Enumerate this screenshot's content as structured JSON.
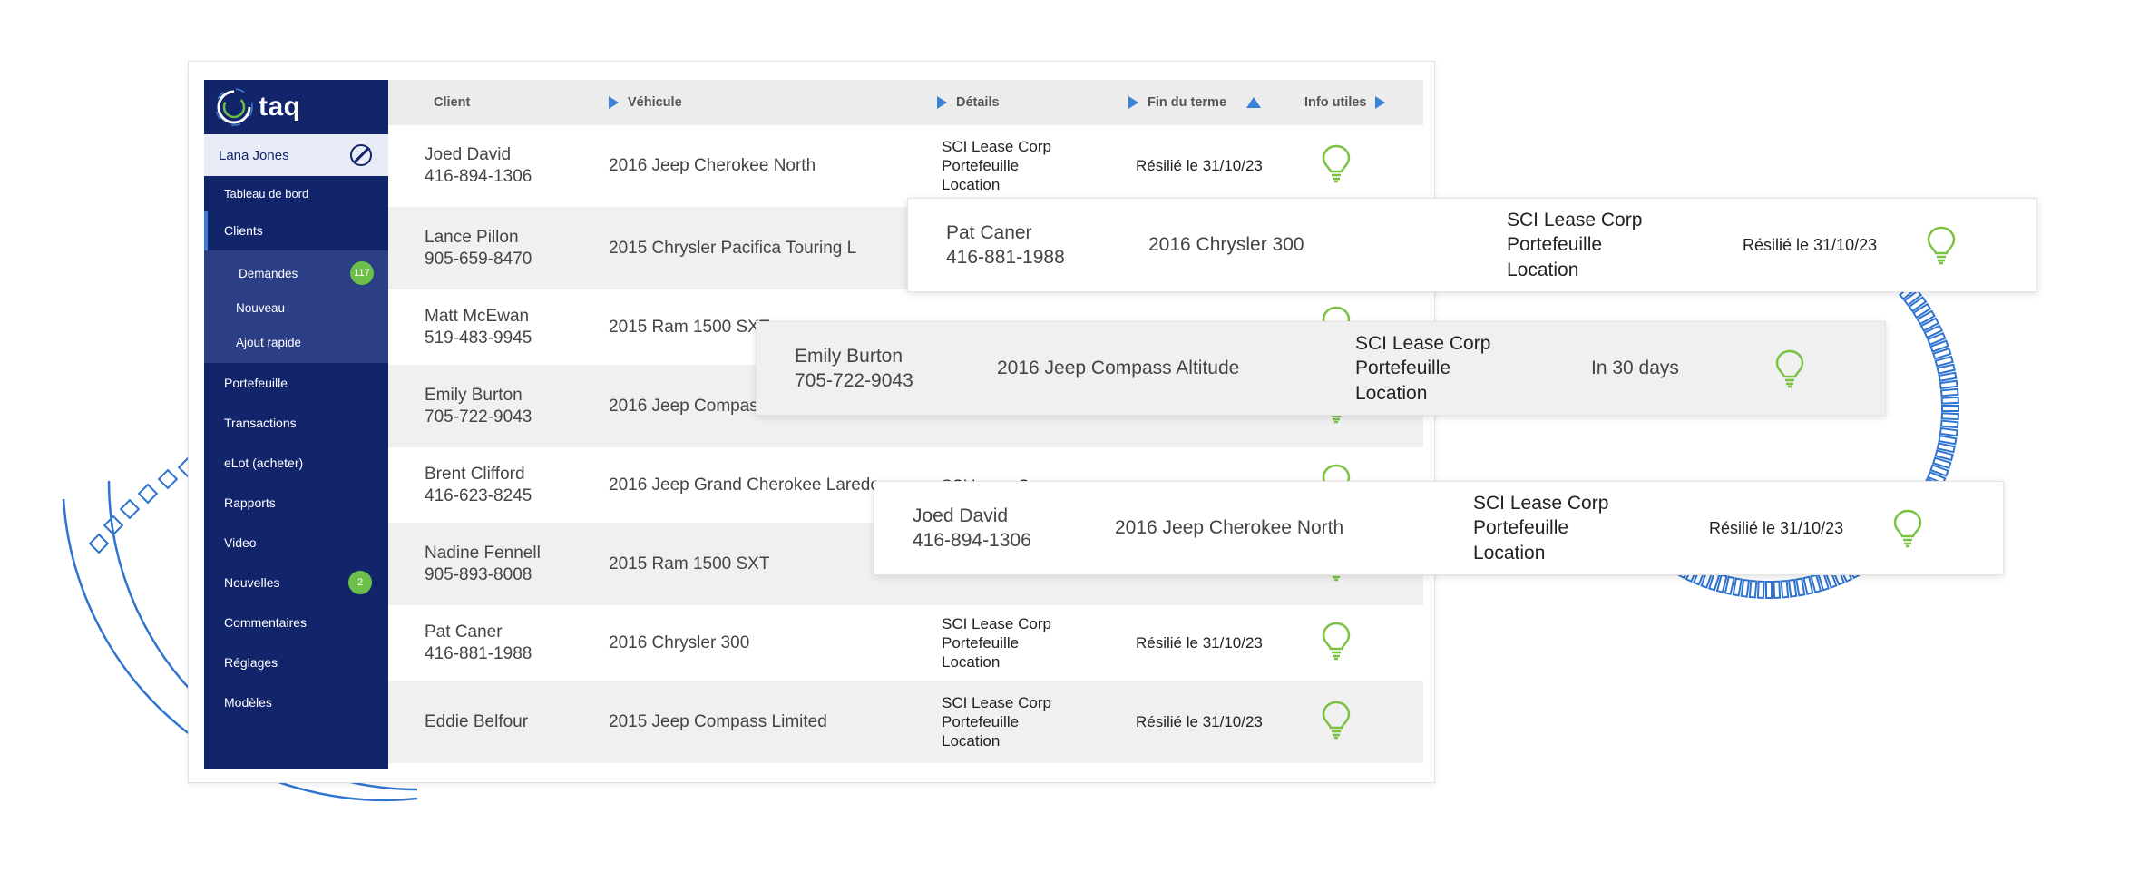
{
  "brand": {
    "logo_text": "taq",
    "accent": "#12246a",
    "link_blue": "#3b82d6",
    "badge_green": "#6cc04a"
  },
  "user": {
    "name": "Lana Jones"
  },
  "sidebar": {
    "overlap_label": "Tableau de bord",
    "clients_label": "Clients",
    "sub_items": [
      {
        "label": "Demandes",
        "badge": "117"
      },
      {
        "label": "Nouveau"
      },
      {
        "label": "Ajout rapide"
      }
    ],
    "items": [
      {
        "label": "Portefeuille"
      },
      {
        "label": "Transactions"
      },
      {
        "label": "eLot (acheter)"
      },
      {
        "label": "Rapports"
      },
      {
        "label": "Video"
      },
      {
        "label": "Nouvelles",
        "badge": "2"
      },
      {
        "label": "Commentaires"
      },
      {
        "label": "Réglages"
      },
      {
        "label": "Modèles"
      }
    ]
  },
  "table": {
    "headers": {
      "client": "Client",
      "vehicle": "Véhicule",
      "details": "Détails",
      "end": "Fin du terme",
      "info": "Info utiles"
    },
    "rows": [
      {
        "name": "Joed David",
        "phone": "416-894-1306",
        "vehicle": "2016 Jeep Cherokee North",
        "d1": "SCI Lease Corp",
        "d2": "Portefeuille",
        "d3": "Location",
        "end": "Résilié le 31/10/23"
      },
      {
        "name": "Lance Pillon",
        "phone": "905-659-8470",
        "vehicle": "2015 Chrysler Pacifica Touring L",
        "d1": "",
        "d2": "",
        "d3": "",
        "end": ""
      },
      {
        "name": "Matt McEwan",
        "phone": "519-483-9945",
        "vehicle": "2015 Ram 1500 SXT",
        "d1": "",
        "d2": "",
        "d3": "",
        "end": ""
      },
      {
        "name": "Emily Burton",
        "phone": "705-722-9043",
        "vehicle": "2016 Jeep Compass",
        "d1": "",
        "d2": "",
        "d3": "Location",
        "end": ""
      },
      {
        "name": "Brent Clifford",
        "phone": "416-623-8245",
        "vehicle": "2016 Jeep Grand Cherokee Laredo",
        "d1": "SCI Lease Corp",
        "d2": "",
        "d3": "",
        "end": ""
      },
      {
        "name": "Nadine Fennell",
        "phone": "905-893-8008",
        "vehicle": "2015 Ram 1500 SXT",
        "d1": "",
        "d2": "",
        "d3": "Location",
        "end": ""
      },
      {
        "name": "Pat Caner",
        "phone": "416-881-1988",
        "vehicle": "2016 Chrysler 300",
        "d1": "SCI Lease Corp",
        "d2": "Portefeuille",
        "d3": "Location",
        "end": "Résilié le 31/10/23"
      },
      {
        "name": "Eddie Belfour",
        "phone": "",
        "vehicle": "2015 Jeep Compass Limited",
        "d1": "SCI Lease Corp",
        "d2": "Portefeuille",
        "d3": "Location",
        "end": "Résilié le 31/10/23"
      }
    ]
  },
  "cards": [
    {
      "name": "Pat Caner",
      "phone": "416-881-1988",
      "vehicle": "2016 Chrysler 300",
      "d1": "SCI Lease Corp",
      "d2": "Portefeuille",
      "d3": "Location",
      "end": "Résilié le 31/10/23"
    },
    {
      "name": "Emily Burton",
      "phone": "705-722-9043",
      "vehicle": "2016 Jeep Compass Altitude",
      "d1": "SCI Lease Corp",
      "d2": "Portefeuille",
      "d3": "Location",
      "end": "In 30 days"
    },
    {
      "name": "Joed David",
      "phone": "416-894-1306",
      "vehicle": "2016 Jeep Cherokee North",
      "d1": "SCI Lease Corp",
      "d2": "Portefeuille",
      "d3": "Location",
      "end": "Résilié le 31/10/23"
    }
  ]
}
